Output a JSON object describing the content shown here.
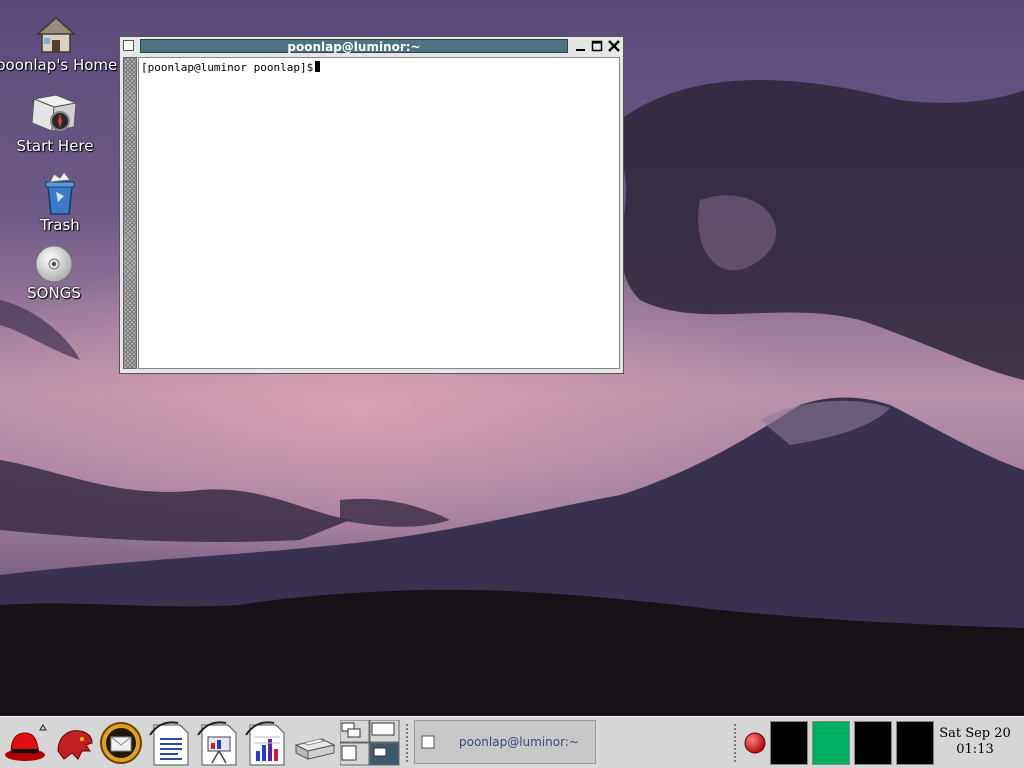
{
  "desktop": {
    "icons": [
      {
        "label": "poonlap's Home",
        "icon": "home-icon"
      },
      {
        "label": "Start Here",
        "icon": "start-here-icon"
      },
      {
        "label": "Trash",
        "icon": "trash-icon"
      },
      {
        "label": "SONGS",
        "icon": "cd-icon"
      }
    ]
  },
  "terminal": {
    "title": "poonlap@luminor:~",
    "prompt": "[poonlap@luminor poonlap]$"
  },
  "panel": {
    "launchers": [
      "redhat-menu-icon",
      "mozilla-icon",
      "evolution-icon",
      "writer-icon",
      "impress-icon",
      "calc-icon",
      "printer-icon"
    ],
    "task": "poonlap@luminor:~",
    "workspaces": {
      "count": 4,
      "active_index": 1
    },
    "clock": {
      "date": "Sat Sep 20",
      "time": "01:13"
    },
    "colors": {
      "panel": "#d6d6d6",
      "active_workspace": "#00b060",
      "title_bar": "#4d7381"
    }
  }
}
